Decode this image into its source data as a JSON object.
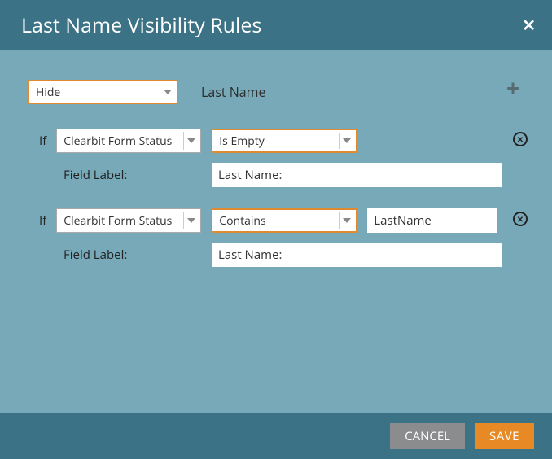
{
  "header": {
    "title": "Last Name Visibility Rules"
  },
  "top": {
    "action": "Hide",
    "field_name": "Last Name"
  },
  "rules": [
    {
      "if": "If",
      "field": "Clearbit Form Status",
      "condition": "Is Empty",
      "value": null,
      "field_label_caption": "Field Label:",
      "field_label_value": "Last Name:"
    },
    {
      "if": "If",
      "field": "Clearbit Form Status",
      "condition": "Contains",
      "value": "LastName",
      "field_label_caption": "Field Label:",
      "field_label_value": "Last Name:"
    }
  ],
  "footer": {
    "cancel": "CANCEL",
    "save": "SAVE"
  }
}
